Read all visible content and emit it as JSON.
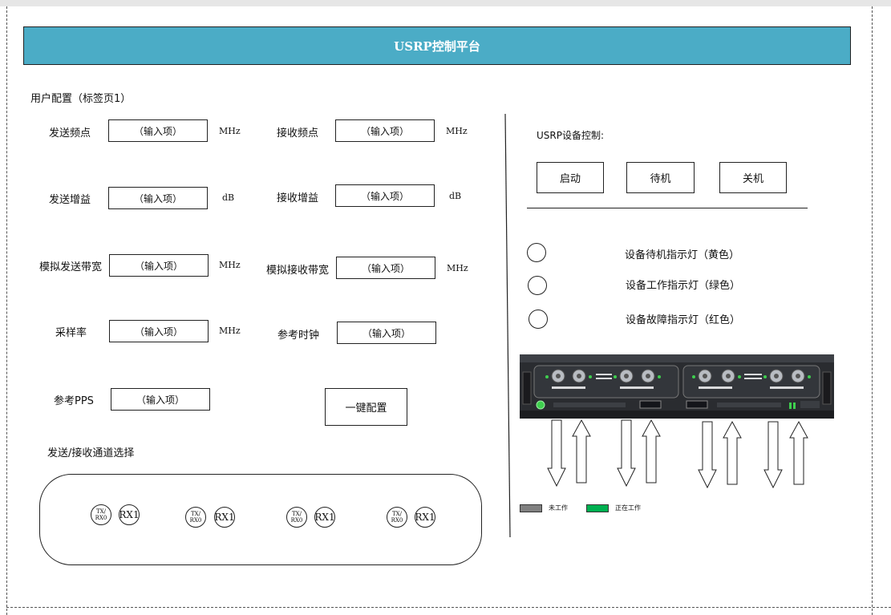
{
  "header": {
    "title": "USRP控制平台"
  },
  "config": {
    "section_title": "用户配置（标签页1）",
    "fields": {
      "tx_freq": {
        "label": "发送频点",
        "placeholder": "（输入项）",
        "unit": "MHz"
      },
      "rx_freq": {
        "label": "接收频点",
        "placeholder": "（输入项）",
        "unit": "MHz"
      },
      "tx_gain": {
        "label": "发送增益",
        "placeholder": "（输入项）",
        "unit": "dB"
      },
      "rx_gain": {
        "label": "接收增益",
        "placeholder": "（输入项）",
        "unit": "dB"
      },
      "tx_bw": {
        "label": "模拟发送带宽",
        "placeholder": "（输入项）",
        "unit": "MHz"
      },
      "rx_bw": {
        "label": "模拟接收带宽",
        "placeholder": "（输入项）",
        "unit": "MHz"
      },
      "samp_rate": {
        "label": "采样率",
        "placeholder": "（输入项）",
        "unit": "MHz"
      },
      "ref_clock": {
        "label": "参考时钟",
        "placeholder": "（输入项）"
      },
      "ref_pps": {
        "label": "参考PPS",
        "placeholder": "（输入项）"
      }
    },
    "one_click_button": "一键配置",
    "channel_section_title": "发送/接收通道选择",
    "channels": [
      {
        "txrx": "TX/\nRX0",
        "rx": "RX1"
      },
      {
        "txrx": "TX/\nRX0",
        "rx": "RX1"
      },
      {
        "txrx": "TX/\nRX0",
        "rx": "RX1"
      },
      {
        "txrx": "TX/\nRX0",
        "rx": "RX1"
      }
    ]
  },
  "device": {
    "section_title": "USRP设备控制:",
    "buttons": {
      "start": "启动",
      "standby": "待机",
      "shutdown": "关机"
    },
    "indicators": [
      {
        "label": "设备待机指示灯（黄色）"
      },
      {
        "label": "设备工作指示灯（绿色）"
      },
      {
        "label": "设备故障指示灯（红色）"
      }
    ],
    "legend": [
      {
        "label": "未工作",
        "color": "#808080"
      },
      {
        "label": "正在工作",
        "color": "#00b050"
      }
    ]
  }
}
